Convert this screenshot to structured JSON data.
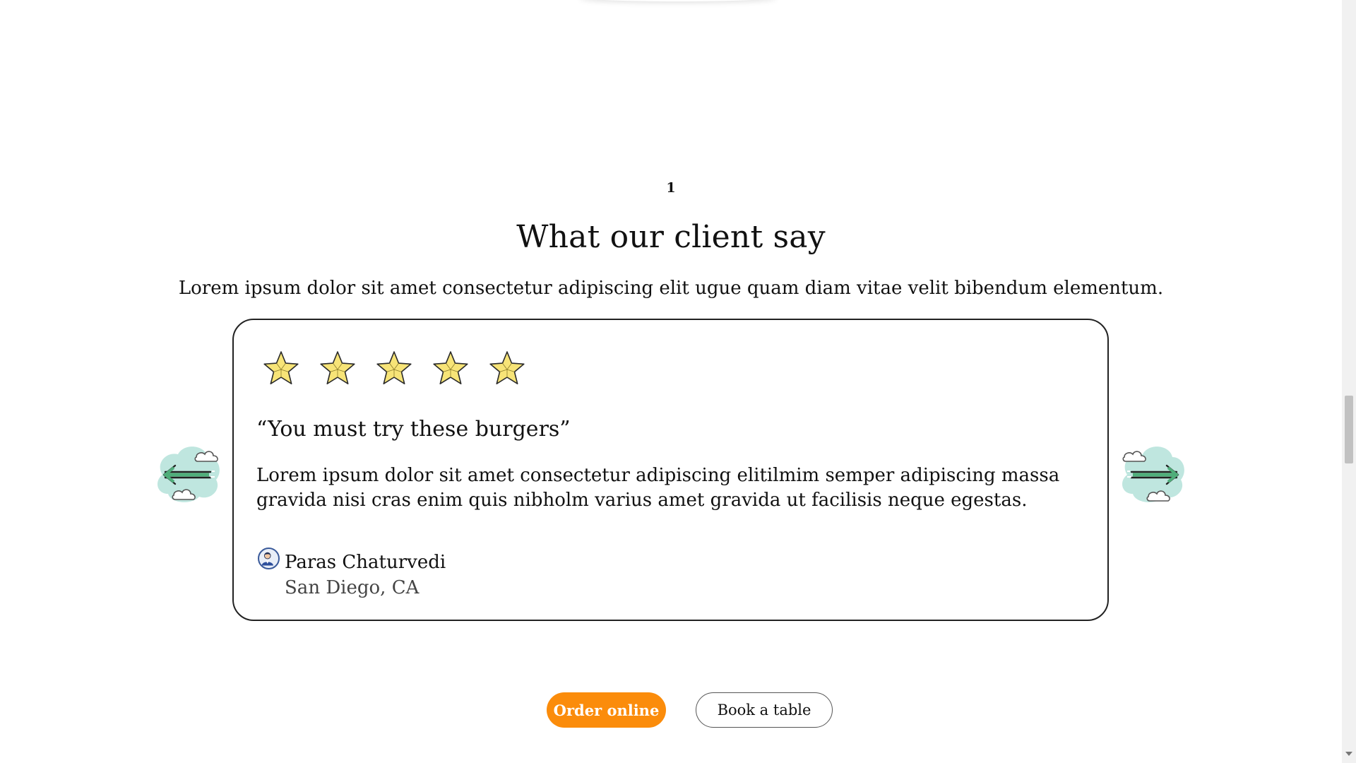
{
  "section": {
    "number": "1",
    "title": "What our client say",
    "subtitle": "Lorem ipsum dolor sit amet consectetur adipiscing elit ugue quam diam vitae velit bibendum elementum."
  },
  "testimonial": {
    "rating": 5,
    "rating_max": 5,
    "quote_title": "“You must try these burgers”",
    "quote_body": "Lorem ipsum dolor sit amet consectetur adipiscing elitilmim semper adipiscing massa gravida nisi cras enim quis nibholm varius amet gravida ut facilisis neque egestas.",
    "author_name": "Paras Chaturvedi",
    "author_location": "San Diego, CA"
  },
  "navigation": {
    "prev_icon": "arrow-left-cloud-icon",
    "next_icon": "arrow-right-cloud-icon"
  },
  "actions": {
    "order_label": "Order online",
    "book_label": "Book a table"
  },
  "colors": {
    "accent": "#fb8c0b",
    "star_fill": "#f7e477",
    "cloud": "#bfe6df",
    "arrow": "#4fae7a"
  }
}
